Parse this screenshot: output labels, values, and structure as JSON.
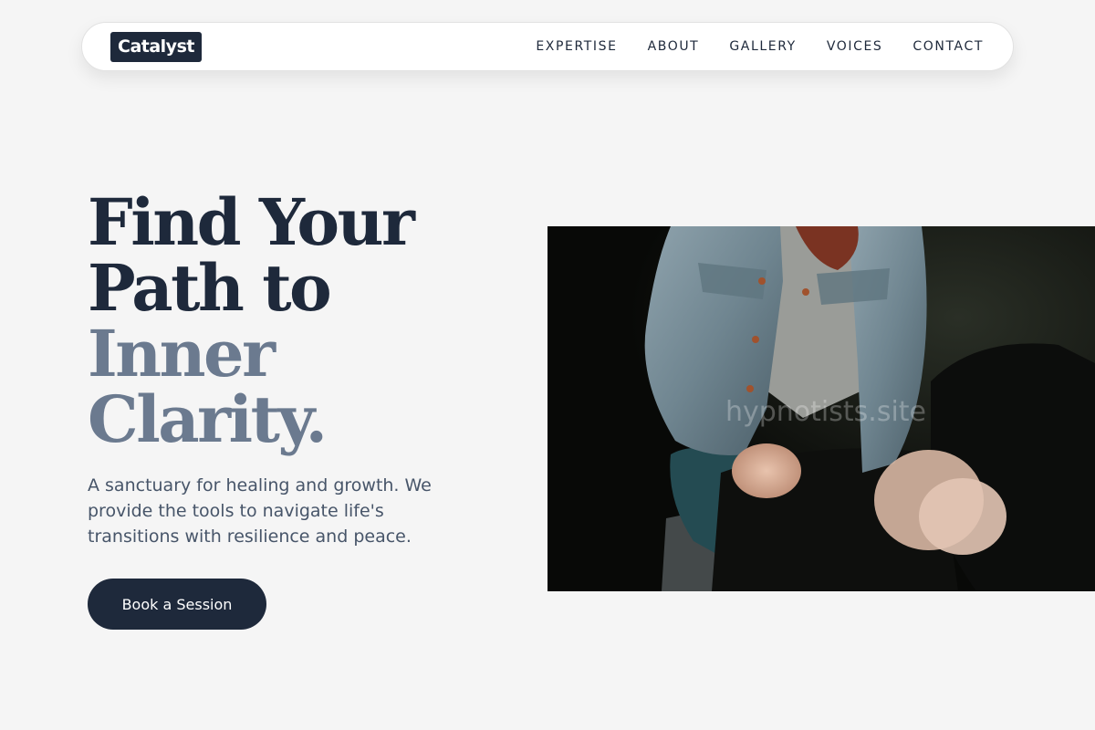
{
  "brand": {
    "logo_text": "Catalyst"
  },
  "nav": {
    "links": [
      {
        "label": "EXPERTISE"
      },
      {
        "label": "ABOUT"
      },
      {
        "label": "GALLERY"
      },
      {
        "label": "VOICES"
      },
      {
        "label": "CONTACT"
      }
    ]
  },
  "hero": {
    "headline_line1": "Find Your",
    "headline_line2": "Path to",
    "headline_line3": "Inner",
    "headline_line4": "Clarity.",
    "subtext": "A sanctuary for healing and growth. We provide the tools to navigate life's transitions with resilience and peace.",
    "cta_label": "Book a Session",
    "image_watermark": "hypnotists.site"
  },
  "colors": {
    "primary": "#1e293b",
    "muted_headline": "#6b7a8f",
    "body_text": "#475569",
    "background": "#f5f5f5"
  }
}
